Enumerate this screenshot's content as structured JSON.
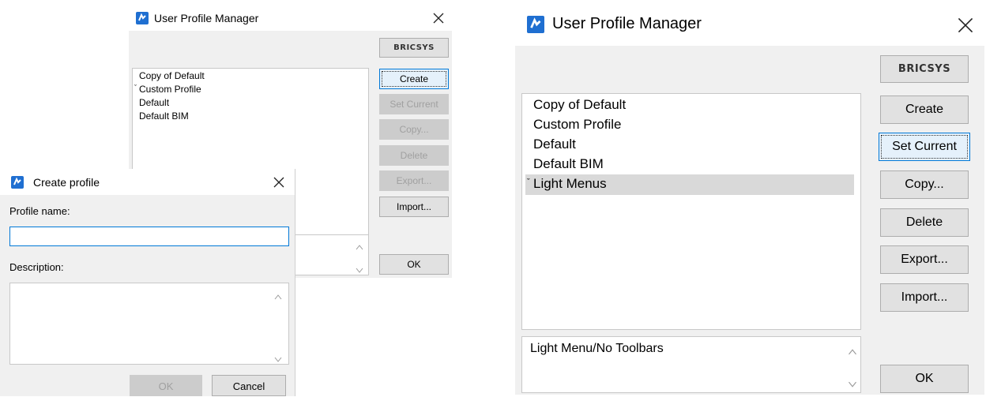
{
  "colors": {
    "accent": "#0078d7",
    "app_icon": "#1f6fd1",
    "dialog_bg": "#f0f0f0",
    "selection": "#d9d9d9"
  },
  "left_manager": {
    "title": "User Profile Manager",
    "logo": "BRICSYS",
    "profiles": [
      "Copy of Default",
      "Custom Profile",
      "Default",
      "Default BIM"
    ],
    "current_profile_index": 1,
    "buttons": {
      "create": "Create",
      "set_current": "Set Current",
      "copy": "Copy...",
      "delete": "Delete",
      "export": "Export...",
      "import": "Import...",
      "ok": "OK"
    }
  },
  "create_profile": {
    "title": "Create profile",
    "profile_name_label": "Profile name:",
    "profile_name_value": "",
    "description_label": "Description:",
    "description_value": "",
    "ok_label": "OK",
    "cancel_label": "Cancel"
  },
  "right_manager": {
    "title": "User Profile Manager",
    "logo": "BRICSYS",
    "profiles": [
      "Copy of Default",
      "Custom Profile",
      "Default",
      "Default BIM",
      "Light Menus"
    ],
    "current_profile_index": 4,
    "description": "Light Menu/No Toolbars",
    "buttons": {
      "create": "Create",
      "set_current": "Set Current",
      "copy": "Copy...",
      "delete": "Delete",
      "export": "Export...",
      "import": "Import...",
      "ok": "OK"
    }
  },
  "icons": {
    "app": "bricscad-app-icon",
    "close": "close-icon",
    "current_marker": "checkmark-icon",
    "scroll_up": "scroll-up-icon",
    "scroll_down": "scroll-down-icon"
  }
}
